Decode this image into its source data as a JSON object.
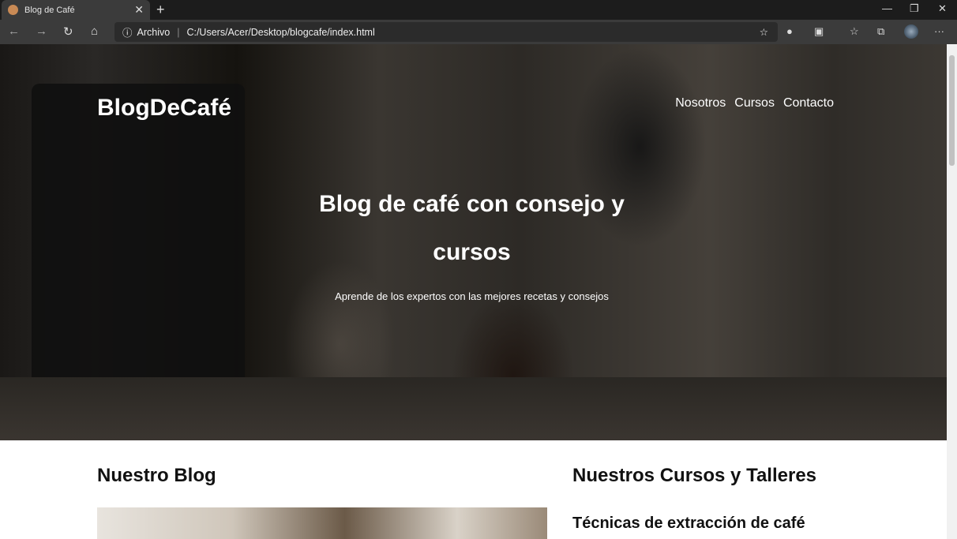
{
  "browser": {
    "tab_title": "Blog de Café",
    "address_prefix": "Archivo",
    "url": "C:/Users/Acer/Desktop/blogcafe/index.html"
  },
  "site": {
    "logo": "BlogDeCafé",
    "nav": [
      "Nosotros",
      "Cursos",
      "Contacto"
    ],
    "hero_title": "Blog de café con consejo y cursos",
    "hero_subtitle": "Aprende de los expertos con las mejores recetas y consejos"
  },
  "main": {
    "blog_heading": "Nuestro Blog",
    "courses_heading": "Nuestros Cursos y Talleres",
    "course_1": "Técnicas de extracción de café"
  }
}
